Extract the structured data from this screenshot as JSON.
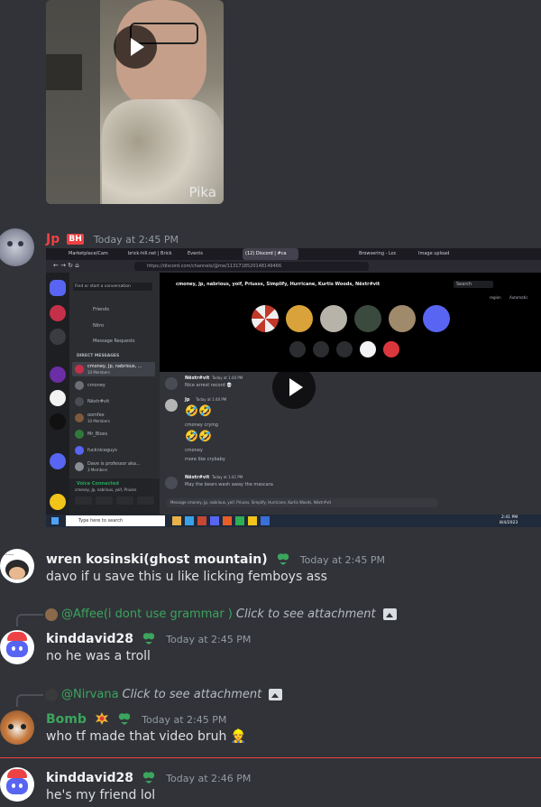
{
  "video1": {
    "watermark": "Pika"
  },
  "messages": [
    {
      "author": "Jp",
      "tag": "BH",
      "timestamp": "Today at 2:45 PM",
      "author_color": "#f23f43",
      "attachment": {
        "tabs": [
          "Marketplace/Cam",
          "brick-hill.net | Brick",
          "Events",
          "(12) Discord | #ca",
          "Browsering - Loc",
          "Image upload"
        ],
        "url": "https://discord.com/channels/@me/1131718520148149466",
        "channel_members": "cmoney, Jp, nabrious, yoif, Priusss, Simplify, Hurricane, Kurtis Woods, Nëxtr#vit",
        "search_placeholder": "Search",
        "find_placeholder": "Find or start a conversation",
        "nav": [
          "Friends",
          "Nitro",
          "Message Requests"
        ],
        "dm_header": "DIRECT MESSAGES",
        "dms": [
          {
            "name": "cmoney, Jp, nabrious, ...",
            "sub": "10 Members"
          },
          {
            "name": "cmoney",
            "sub": ""
          },
          {
            "name": "Nëxtr#vit",
            "sub": ""
          },
          {
            "name": "oomfex",
            "sub": "10 Members"
          },
          {
            "name": "Mr_Bloxs",
            "sub": ""
          },
          {
            "name": "fuckniceguys",
            "sub": ""
          },
          {
            "name": "Dave is professor aka...",
            "sub": "3 Members"
          }
        ],
        "voice_status": "Voice Connected",
        "voice_sub": "cmoney, Jp, nabrious, yoif, Priusss",
        "region_label": "region",
        "region_value": "Automatic",
        "chat": [
          {
            "author": "Nëxtr#vit",
            "time": "Today at 1:40 PM",
            "lines": [
              "Nice arrest record 💀"
            ]
          },
          {
            "author": "Jp",
            "time": "Today at 1:40 PM",
            "lines": [
              "🤣🤣",
              "cmoney crying",
              "🤣🤣",
              "cmoney",
              "more like crybaby"
            ]
          },
          {
            "author": "Nëxtr#vit",
            "time": "Today at 1:41 PM",
            "lines": [
              "May the bears wash away the mascara"
            ]
          }
        ],
        "input_placeholder": "Message cmoney, Jp, nabrious, yoif, Priusss, Simplify, Hurricane, Kurtis Woods, Nëxtr#vit",
        "taskbar_search": "Type here to search",
        "clock_time": "2:41 PM",
        "clock_date": "8/4/2023"
      }
    },
    {
      "author": "wren kosinski(ghost mountain)",
      "timestamp": "Today at 2:45 PM",
      "author_color": "#f2f3f5",
      "text": "davo if u save this u like licking femboys ass"
    },
    {
      "reply": {
        "mention": "@Affee(i dont use grammar )",
        "note": "Click to see attachment"
      },
      "author": "kinddavid28",
      "timestamp": "Today at 2:45 PM",
      "author_color": "#f2f3f5",
      "text": "no he was a troll"
    },
    {
      "reply": {
        "mention": "@Nirvana",
        "note": "Click to see attachment"
      },
      "author": "Bomb",
      "timestamp": "Today at 2:45 PM",
      "author_color": "#3ba55d",
      "text": "who tf made that video bruh 👷"
    },
    {
      "author": "kinddavid28",
      "timestamp": "Today at 2:46 PM",
      "author_color": "#f2f3f5",
      "text": "he's my friend lol"
    }
  ],
  "colors": {
    "background": "#313338",
    "accent_green": "#3ba55d",
    "new_divider": "#f23f43",
    "discord_blurple": "#5865f2"
  }
}
